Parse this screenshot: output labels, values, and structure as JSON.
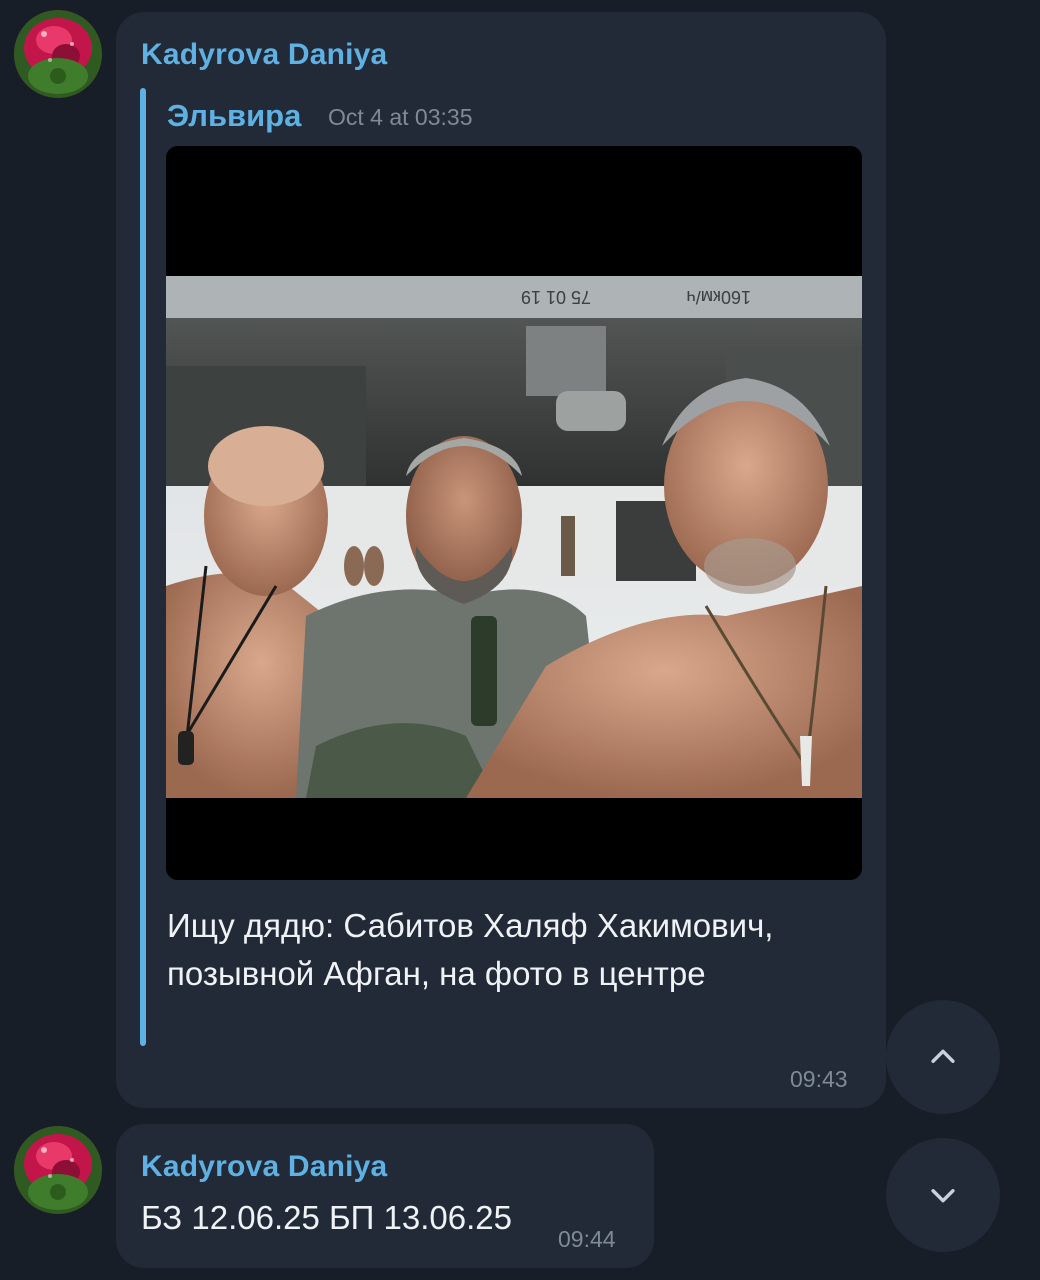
{
  "messages": [
    {
      "sender": "Kadyrova Daniya",
      "reply": {
        "name": "Эльвира",
        "time": "Oct 4 at 03:35",
        "photo_text_left": "75 01 19",
        "photo_text_right": "160км/ч",
        "caption": "Ищу дядю: Сабитов Халяф Хакимович, позывной Афган, на фото в центре"
      },
      "time": "09:43"
    },
    {
      "sender": "Kadyrova Daniya",
      "text": "БЗ 12.06.25 БП 13.06.25",
      "time": "09:44"
    }
  ],
  "controls": {
    "scroll_up_icon": "chevron-up-icon",
    "scroll_down_icon": "chevron-down-icon"
  },
  "colors": {
    "background": "#181e27",
    "bubble": "#212a36",
    "accent": "#5fb1e4",
    "meta_text": "#7f8a97"
  }
}
